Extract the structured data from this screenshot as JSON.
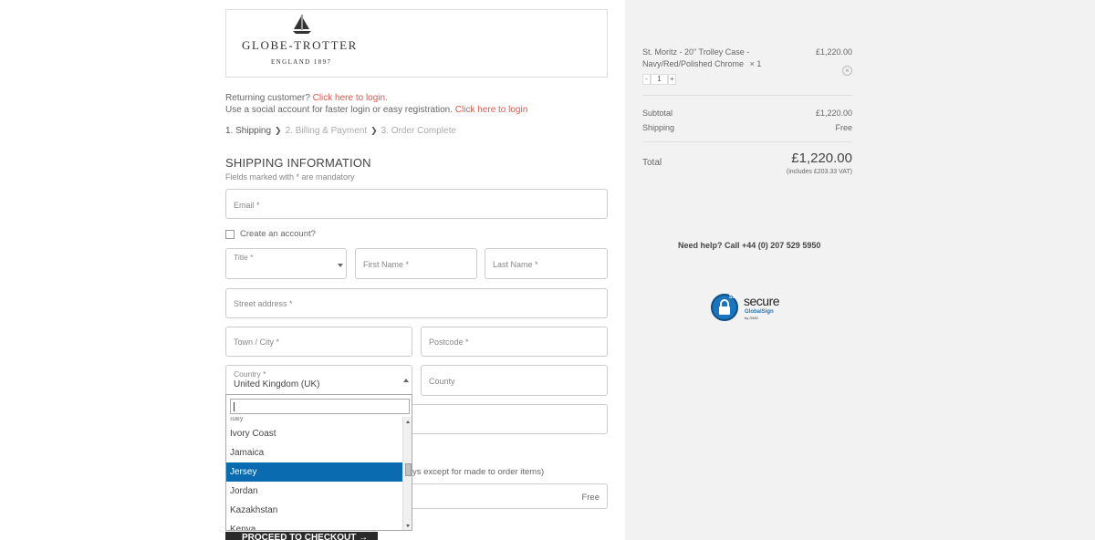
{
  "brand": {
    "name": "GLOBE-TROTTER",
    "tagline": "ENGLAND 1897"
  },
  "login": {
    "returning_text": "Returning customer?",
    "returning_link": "Click here to login.",
    "social_text": "Use a social account for faster login or easy registration.",
    "social_link": "Click here to login"
  },
  "steps": [
    {
      "label": "1. Shipping"
    },
    {
      "label": "2. Billing & Payment"
    },
    {
      "label": "3. Order Complete"
    }
  ],
  "shipping": {
    "title": "SHIPPING INFORMATION",
    "subtitle": "Fields marked with * are mandatory",
    "email_placeholder": "Email *",
    "create_account_label": "Create an account?",
    "title_label": "Title *",
    "first_name_placeholder": "First Name *",
    "last_name_placeholder": "Last Name *",
    "street_placeholder": "Street address *",
    "town_placeholder": "Town / City *",
    "postcode_placeholder": "Postcode *",
    "country_label": "Country *",
    "country_value": "United Kingdom (UK)",
    "county_placeholder": "County",
    "delivery_note_partial": "ys except for made to order items)",
    "delivery_price": "Free"
  },
  "country_dropdown": {
    "items": [
      {
        "label": "Italy"
      },
      {
        "label": "Ivory Coast"
      },
      {
        "label": "Jamaica"
      },
      {
        "label": "Jersey",
        "selected": true
      },
      {
        "label": "Jordan"
      },
      {
        "label": "Kazakhstan"
      },
      {
        "label": "Kenya"
      }
    ]
  },
  "checkout_button": "PROCEED TO CHECKOUT →",
  "cart": {
    "item_name_line1": "St. Moritz - 20\" Trolley Case -",
    "item_name_line2": "Navy/Red/Polished Chrome",
    "item_qty_label": "× 1",
    "item_price": "£1,220.00",
    "qty_minus": "-",
    "qty_value": "1",
    "qty_plus": "+",
    "remove": "×",
    "subtotal_label": "Subtotal",
    "subtotal_value": "£1,220.00",
    "shipping_label": "Shipping",
    "shipping_value": "Free",
    "total_label": "Total",
    "total_value": "£1,220.00",
    "vat_note": "(includes £203.33 VAT)"
  },
  "help": {
    "text": "Need help? Call +44 (0) 207 529 5950"
  },
  "ssl": {
    "badge": "SSL",
    "title": "secure",
    "provider": "GlobalSign",
    "by": "by GMO"
  },
  "colors": {
    "link": "#e55347",
    "selected": "#0a6bb0",
    "panel_bg": "#f2f2f2"
  }
}
